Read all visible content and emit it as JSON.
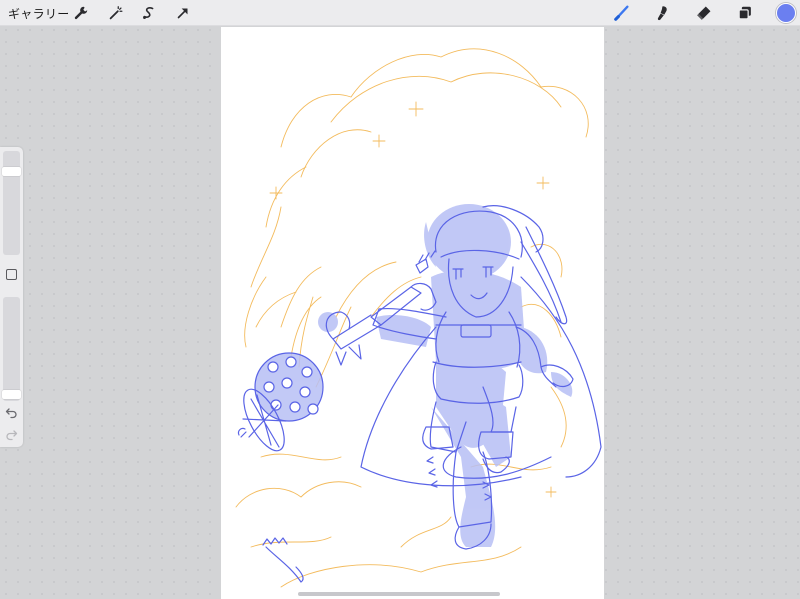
{
  "toolbar": {
    "gallery_label": "ギャラリー",
    "left_tools": [
      "wrench-icon",
      "magic-wand-icon",
      "selection-icon",
      "transform-arrow-icon"
    ],
    "right_tools": [
      "brush-icon",
      "smudge-icon",
      "eraser-icon",
      "layers-icon"
    ]
  },
  "colors": {
    "active_color": "#6b7ff0",
    "active_tool": "#3c78f0",
    "sketch_blue": "#5a64e6",
    "fill_blue": "#b7bff5",
    "sketch_orange": "#f2b44c",
    "toolbar_bg": "#ececee",
    "canvas_bg": "#ffffff",
    "workspace_bg": "#d3d4d6"
  },
  "sidebar": {
    "brush_size_level": 0.83,
    "opacity_level": 0.02,
    "undo_icon": "undo-arrow-icon",
    "redo_icon": "redo-arrow-icon"
  }
}
